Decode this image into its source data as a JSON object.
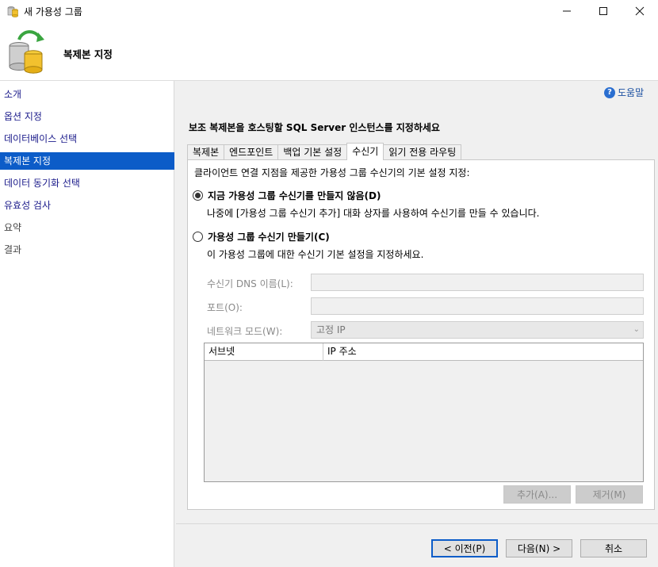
{
  "window": {
    "title": "새 가용성 그룹",
    "icons": [
      "minimize-icon",
      "maximize-icon",
      "close-icon"
    ]
  },
  "header": {
    "title": "복제본 지정"
  },
  "sidebar": {
    "items": [
      {
        "label": "소개",
        "state": "link"
      },
      {
        "label": "옵션 지정",
        "state": "link"
      },
      {
        "label": "데이터베이스 선택",
        "state": "link"
      },
      {
        "label": "복제본 지정",
        "state": "active"
      },
      {
        "label": "데이터 동기화 선택",
        "state": "link"
      },
      {
        "label": "유효성 검사",
        "state": "link"
      },
      {
        "label": "요약",
        "state": "disabled"
      },
      {
        "label": "결과",
        "state": "disabled"
      }
    ]
  },
  "main": {
    "help_label": "도움말",
    "instruction": "보조 복제본을 호스팅할 SQL Server 인스턴스를 지정하세요",
    "tabs": [
      {
        "label": "복제본",
        "active": false
      },
      {
        "label": "엔드포인트",
        "active": false
      },
      {
        "label": "백업 기본 설정",
        "active": false
      },
      {
        "label": "수신기",
        "active": true
      },
      {
        "label": "읽기 전용 라우팅",
        "active": false
      }
    ],
    "listener": {
      "description": "클라이언트 연결 지점을 제공한 가용성 그룹 수신기의 기본 설정 지정:",
      "option_no": {
        "label": "지금 가용성 그룹 수신기를 만들지 않음(D)",
        "desc": "나중에 [가용성 그룹 수신기 추가] 대화 상자를 사용하여 수신기를 만들 수 있습니다.",
        "checked": true
      },
      "option_create": {
        "label": "가용성 그룹 수신기 만들기(C)",
        "desc": "이 가용성 그룹에 대한 수신기 기본 설정을 지정하세요.",
        "checked": false
      },
      "dns_label": "수신기 DNS 이름(L):",
      "dns_value": "",
      "port_label": "포트(O):",
      "port_value": "",
      "network_mode_label": "네트워크 모드(W):",
      "network_mode_value": "고정 IP",
      "grid_columns": [
        "서브넷",
        "IP 주소"
      ],
      "add_button": "추가(A)...",
      "remove_button": "제거(M)"
    }
  },
  "footer": {
    "prev": "< 이전(P)",
    "next": "다음(N) >",
    "cancel": "취소"
  },
  "colors": {
    "accent": "#0c5cc8",
    "link": "#1a1a8a"
  }
}
